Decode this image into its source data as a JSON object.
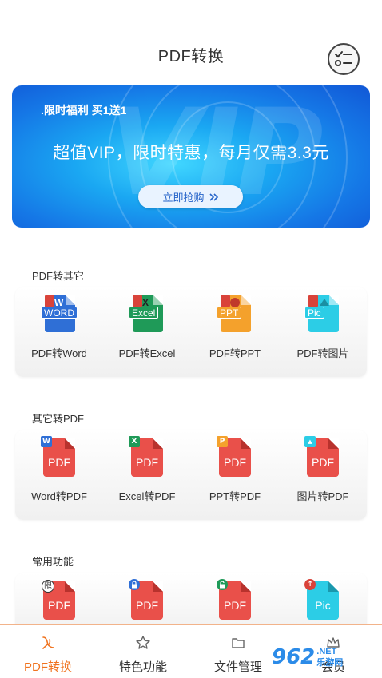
{
  "header": {
    "title": "PDF转换",
    "action_icon": "checklist-icon"
  },
  "banner": {
    "tag": ".限时福利  买1送1",
    "headline": "超值VIP，限时特惠，每月仅需3.3元",
    "button_label": "立即抢购",
    "button_icon": "double-chevron-right-icon",
    "background_text": "VIP"
  },
  "sections": [
    {
      "title": "PDF转其它",
      "items": [
        {
          "label": "PDF转Word",
          "icon_text": "WORD",
          "color": "#2f6fd6"
        },
        {
          "label": "PDF转Excel",
          "icon_text": "Excel",
          "color": "#1f9a58"
        },
        {
          "label": "PDF转PPT",
          "icon_text": "PPT",
          "color": "#f4a12c"
        },
        {
          "label": "PDF转图片",
          "icon_text": "Pic",
          "color": "#2ccde6"
        }
      ]
    },
    {
      "title": "其它转PDF",
      "items": [
        {
          "label": "Word转PDF",
          "icon_text": "PDF",
          "mark": "W",
          "mark_color": "#2f6fd6"
        },
        {
          "label": "Excel转PDF",
          "icon_text": "PDF",
          "mark": "X",
          "mark_color": "#1f9a58"
        },
        {
          "label": "PPT转PDF",
          "icon_text": "PDF",
          "mark": "P",
          "mark_color": "#f4a12c"
        },
        {
          "label": "图片转PDF",
          "icon_text": "PDF",
          "mark": "▲",
          "mark_color": "#2ccde6"
        }
      ]
    },
    {
      "title": "常用功能",
      "items": [
        {
          "icon_text": "PDF",
          "mark": "限",
          "mark_type": "round"
        },
        {
          "icon_text": "PDF",
          "mark": "🔒",
          "mark_color": "#2f6fd6"
        },
        {
          "icon_text": "PDF",
          "mark": "🔓",
          "mark_color": "#1f9a58"
        },
        {
          "icon_text": "Pic",
          "mark": "↑",
          "mark_color": "#d9433a"
        }
      ]
    }
  ],
  "nav": {
    "items": [
      {
        "label": "PDF转换",
        "icon": "pdf-convert-icon",
        "active": true
      },
      {
        "label": "特色功能",
        "icon": "star-icon",
        "active": false
      },
      {
        "label": "文件管理",
        "icon": "folder-icon",
        "active": false
      },
      {
        "label": "会员",
        "icon": "crown-icon",
        "active": false
      }
    ]
  },
  "watermark": {
    "number": "962",
    "domain_top": ".NET",
    "domain_bottom": "乐游网"
  },
  "colors": {
    "accent": "#f0731f",
    "banner_blue": "#1577e6",
    "pdf_red": "#e9504a"
  }
}
